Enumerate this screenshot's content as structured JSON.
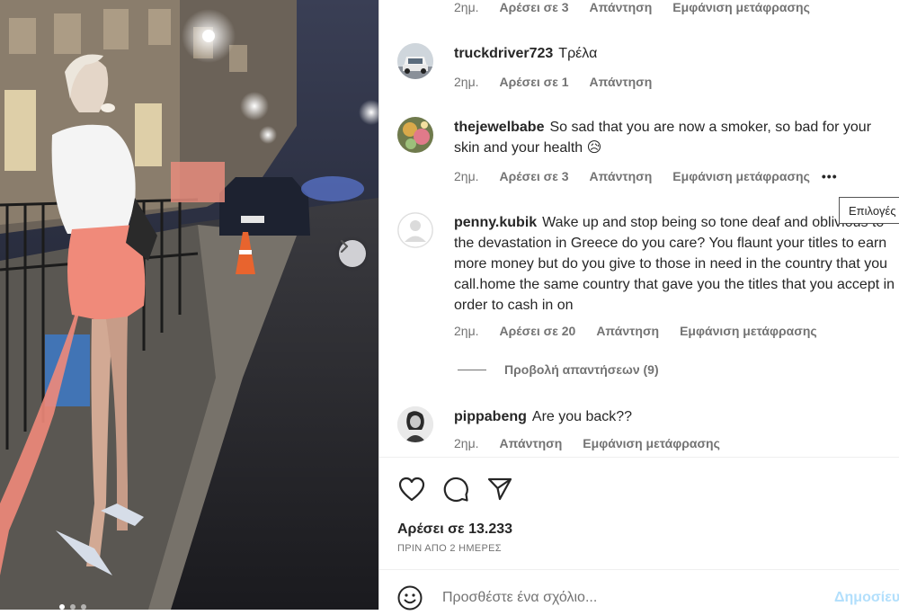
{
  "photo": {
    "alt": "",
    "slide_index": 1,
    "slide_count": 3
  },
  "top_meta": {
    "time": "2ημ.",
    "likes": "Αρέσει σε 3",
    "reply": "Απάντηση",
    "translate": "Εμφάνιση μετάφρασης"
  },
  "comments": [
    {
      "user": "truckdriver723",
      "text": "Τρέλα",
      "time": "2ημ.",
      "likes": "Αρέσει σε 1",
      "reply": "Απάντηση"
    },
    {
      "user": "thejewelbabe",
      "text": "So sad that you are now a smoker, so bad for your skin and your health 😥",
      "time": "2ημ.",
      "likes": "Αρέσει σε 3",
      "reply": "Απάντηση",
      "translate": "Εμφάνιση μετάφρασης",
      "more": "•••"
    },
    {
      "user": "penny.kubik",
      "text": "Wake up and stop being so tone deaf and oblivious to the devastation in Greece do you care? You flaunt your titles to earn more money but do you give to those in need in the country that you call.home the same country that gave you the titles that you accept in order to cash in on",
      "time": "2ημ.",
      "likes": "Αρέσει σε 20",
      "reply": "Απάντηση",
      "translate": "Εμφάνιση μετάφρασης",
      "view_replies": "Προβολή απαντήσεων (9)"
    },
    {
      "user": "pippabeng",
      "text": "Are you back??",
      "time": "2ημ.",
      "reply": "Απάντηση",
      "translate": "Εμφάνιση μετάφρασης"
    }
  ],
  "tooltip": "Επιλογές",
  "post": {
    "likes": "Αρέσει σε 13.233",
    "time_ago": "ΠΡΙΝ ΑΠΟ 2 ΗΜΕΡΕΣ"
  },
  "add_comment": {
    "placeholder": "Προσθέστε ένα σχόλιο...",
    "post_label": "Δημοσίευση"
  },
  "icons": {
    "like": "heart-icon",
    "comment": "comment-bubble-icon",
    "share": "paper-plane-icon",
    "emoji": "smiley-icon",
    "next": "chevron-right-icon"
  }
}
